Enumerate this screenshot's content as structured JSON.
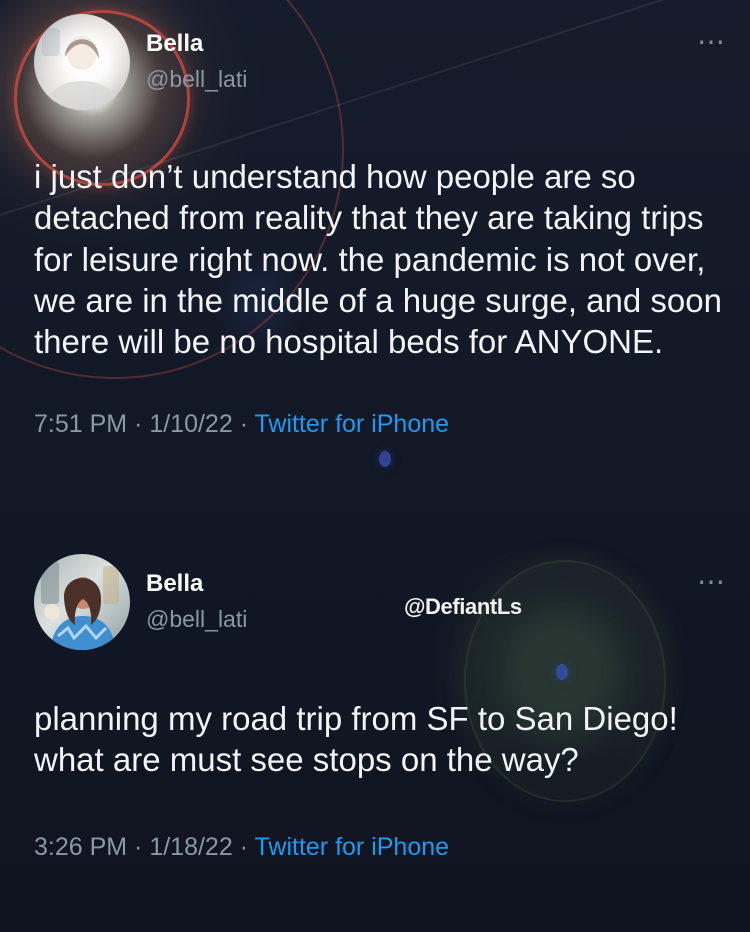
{
  "tweets": [
    {
      "name": "Bella",
      "handle": "@bell_lati",
      "more": "⋯",
      "text": "i just don’t understand how people are so detached from reality that they are taking trips for leisure right now. the pandemic is not over, we are in the middle of a huge surge, and soon there will be no hospital beds for ANYONE.",
      "time": "7:51 PM",
      "date": "1/10/22",
      "client": "Twitter for iPhone"
    },
    {
      "name": "Bella",
      "handle": "@bell_lati",
      "more": "⋯",
      "text": "planning my road trip from SF to San Diego! what are must see stops on the way?",
      "time": "3:26 PM",
      "date": "1/18/22",
      "client": "Twitter for iPhone"
    }
  ],
  "watermark": "@DefiantLs",
  "separator": " · "
}
